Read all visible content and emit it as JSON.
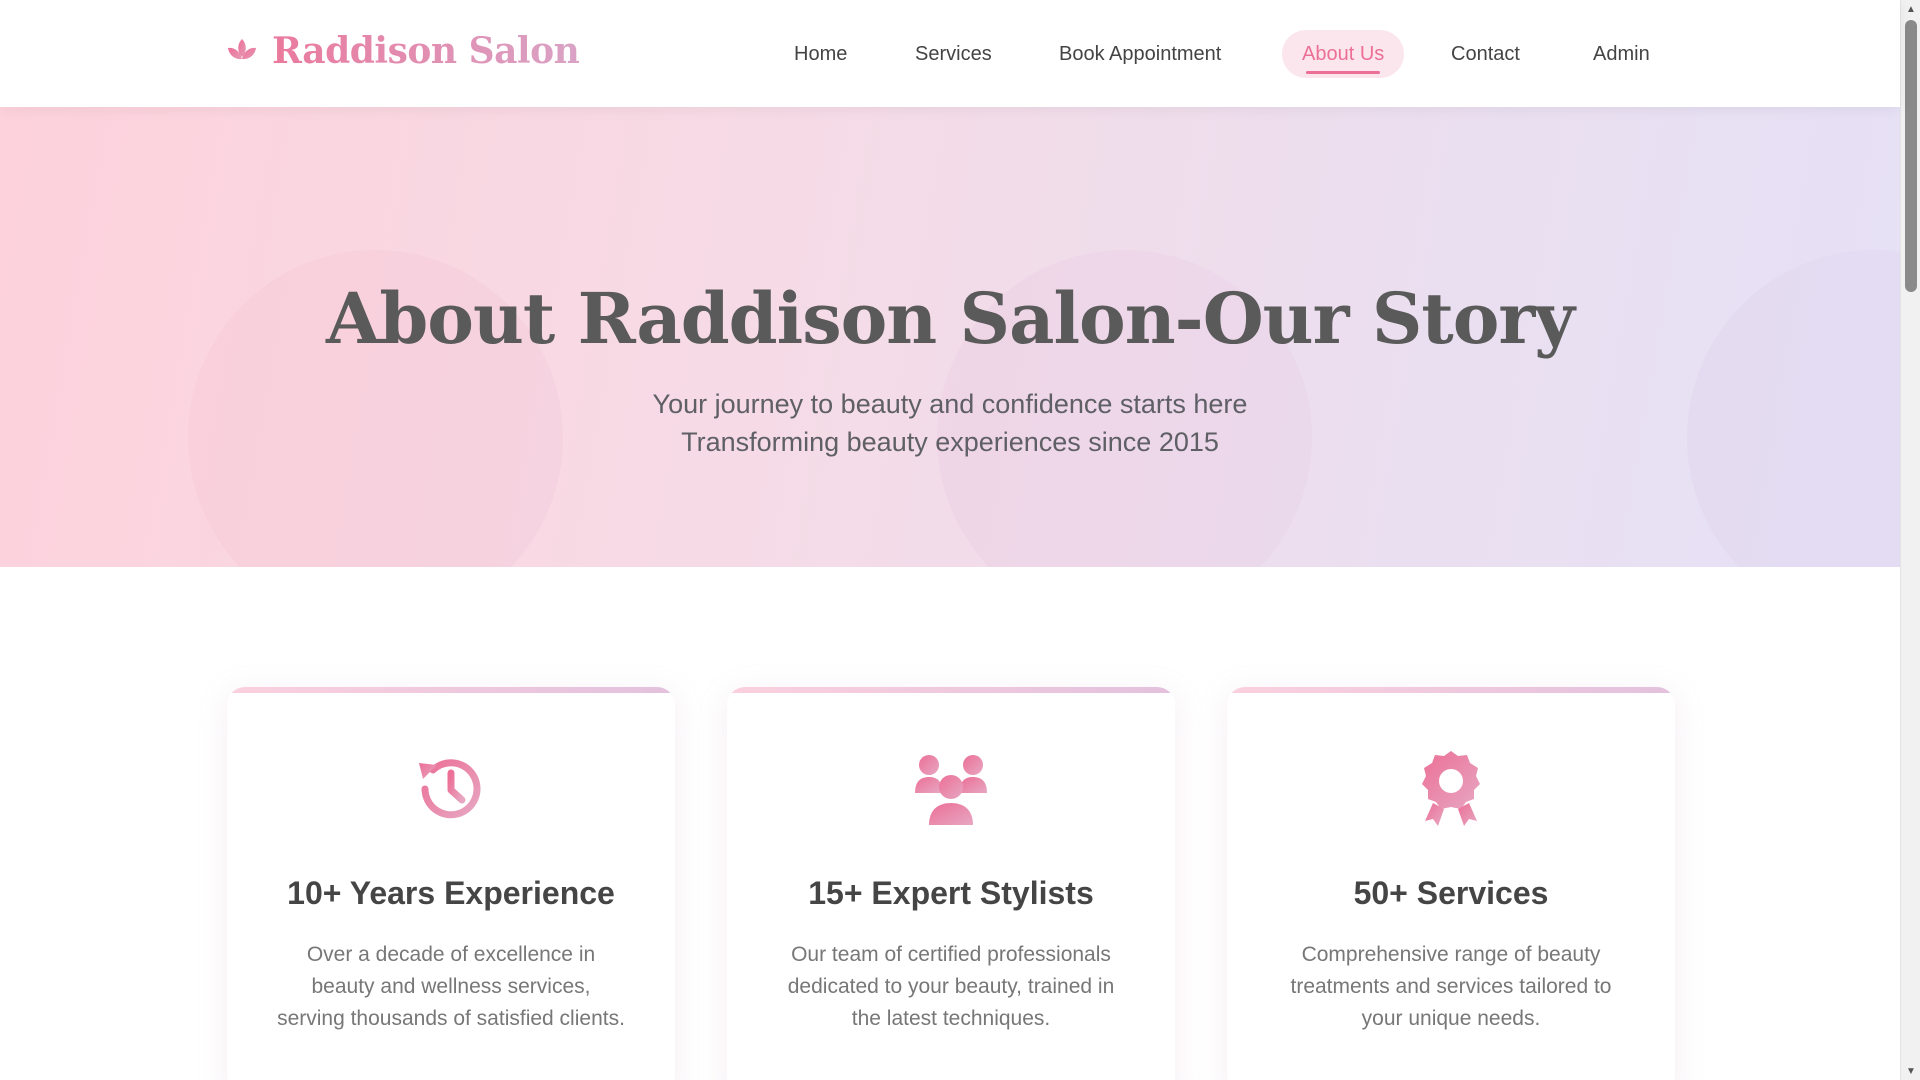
{
  "brand": {
    "name": "Raddison Salon",
    "icon": "lotus-icon",
    "colors": {
      "primary": "#ec6f96",
      "secondary": "#d9a3c5"
    }
  },
  "nav": {
    "items": [
      {
        "label": "Home"
      },
      {
        "label": "Services"
      },
      {
        "label": "Book Appointment"
      },
      {
        "label": "About Us",
        "active": true
      },
      {
        "label": "Contact"
      },
      {
        "label": "Admin"
      }
    ]
  },
  "hero": {
    "title": "About Raddison Salon-Our Story",
    "subtitle_line1": "Your journey to beauty and confidence starts here",
    "subtitle_line2": "Transforming beauty experiences since 2015"
  },
  "features": [
    {
      "icon": "history-clock-icon",
      "title": "10+ Years Experience",
      "text": "Over a decade of excellence in beauty and wellness services, serving thousands of satisfied clients."
    },
    {
      "icon": "users-group-icon",
      "title": "15+ Expert Stylists",
      "text": "Our team of certified professionals dedicated to your beauty, trained in the latest techniques."
    },
    {
      "icon": "award-badge-icon",
      "title": "50+ Services",
      "text": "Comprehensive range of beauty treatments and services tailored to your unique needs."
    }
  ]
}
